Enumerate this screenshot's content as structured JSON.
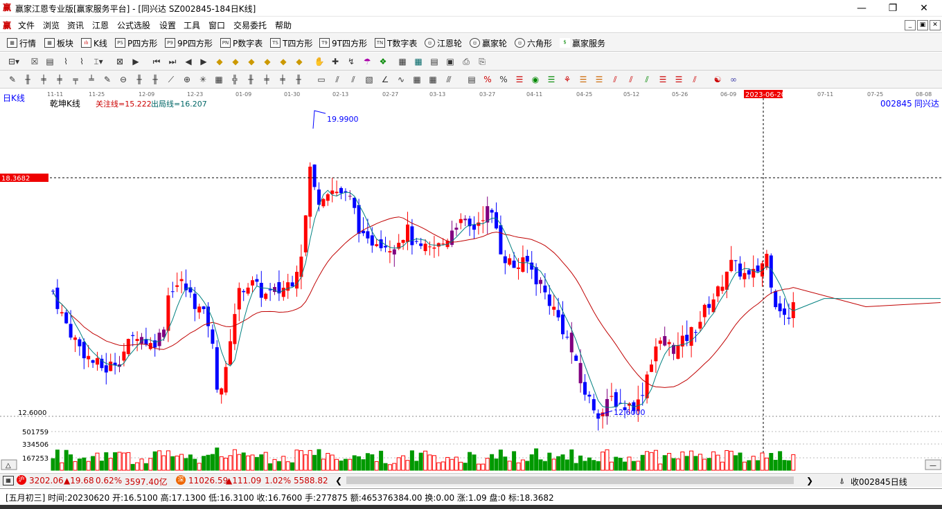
{
  "window": {
    "title": "赢家江恩专业版[赢家服务平台] - [同兴达  SZ002845-184日K线]",
    "logo": "赢",
    "buttons": {
      "minimize": "—",
      "maximize": "❐",
      "close": "✕"
    }
  },
  "menu": {
    "logo": "赢",
    "items": [
      "文件",
      "浏览",
      "资讯",
      "江恩",
      "公式选股",
      "设置",
      "工具",
      "窗口",
      "交易委托",
      "帮助"
    ],
    "mdi": [
      "_",
      "▣",
      "✕"
    ]
  },
  "toolbar1": {
    "items": [
      {
        "label": "行情",
        "icon": "quote-icon",
        "glyph": "▦"
      },
      {
        "label": "板块",
        "icon": "sector-icon",
        "glyph": "▦"
      },
      {
        "label": "K线",
        "icon": "kline-icon",
        "glyph": "ılı"
      },
      {
        "label": "P四方形",
        "icon": "ps-icon",
        "glyph": "PS"
      },
      {
        "label": "9P四方形",
        "icon": "p9-icon",
        "glyph": "P9"
      },
      {
        "label": "P数字表",
        "icon": "pn-icon",
        "glyph": "PN"
      },
      {
        "label": "T四方形",
        "icon": "ts-icon",
        "glyph": "TS"
      },
      {
        "label": "9T四方形",
        "icon": "t9-icon",
        "glyph": "T9"
      },
      {
        "label": "T数字表",
        "icon": "tn-icon",
        "glyph": "TN"
      },
      {
        "label": "江恩轮",
        "icon": "gann-wheel-icon",
        "glyph": "◎"
      },
      {
        "label": "赢家轮",
        "icon": "winner-wheel-icon",
        "glyph": "◎"
      },
      {
        "label": "六角形",
        "icon": "hexagon-icon",
        "glyph": "◎"
      },
      {
        "label": "赢家服务",
        "icon": "service-icon",
        "glyph": "$"
      }
    ]
  },
  "chart_header": {
    "period_label": "日K线",
    "indicator_name": "乾坤K线",
    "focus_line": "关注线=15.222",
    "exit_line": "出局线=16.207",
    "stock_code": "002845",
    "stock_name": "同兴达",
    "crosshair_date": "2023-06-20",
    "crosshair_price": "18.3682",
    "high_label": "19.9900",
    "low_label": "12.6000",
    "left_low_scale": "12.6000",
    "volume_scale": [
      "501759",
      "334506",
      "167253"
    ]
  },
  "chart_data": {
    "type": "candlestick",
    "xaxis_ticks": [
      "11-11",
      "11-25",
      "12-09",
      "12-23",
      "01-09",
      "01-30",
      "02-13",
      "02-27",
      "03-13",
      "03-27",
      "04-11",
      "04-25",
      "05-12",
      "05-26",
      "06-09",
      "2023-06-20",
      "07-11",
      "07-25",
      "08-08"
    ],
    "price_range": [
      12.6,
      19.99
    ],
    "volume_range": [
      0,
      600000
    ],
    "colors": {
      "up": "#ff0000",
      "down": "#0000ff",
      "neutral": "#800080",
      "volume": "#009900",
      "ma_short": "#008080",
      "ma_long": "#c00000"
    }
  },
  "bottom_bar": {
    "sh_index": "3202.06",
    "sh_change": "▲19.68",
    "sh_pct": "0.62%",
    "sh_amount": "3597.40亿",
    "sz_index": "11026.59",
    "sz_change": "▲111.09",
    "sz_pct": "1.02%",
    "sz_amount": "5588.82",
    "right_label": "收002845日线"
  },
  "status": {
    "text": "[五月初三] 时间:20230620 开:16.5100 高:17.1300 低:16.3100 收:16.7600 手:277875 额:465376384.00 换:0.00 涨:1.09 盘:0 标:18.3682"
  }
}
